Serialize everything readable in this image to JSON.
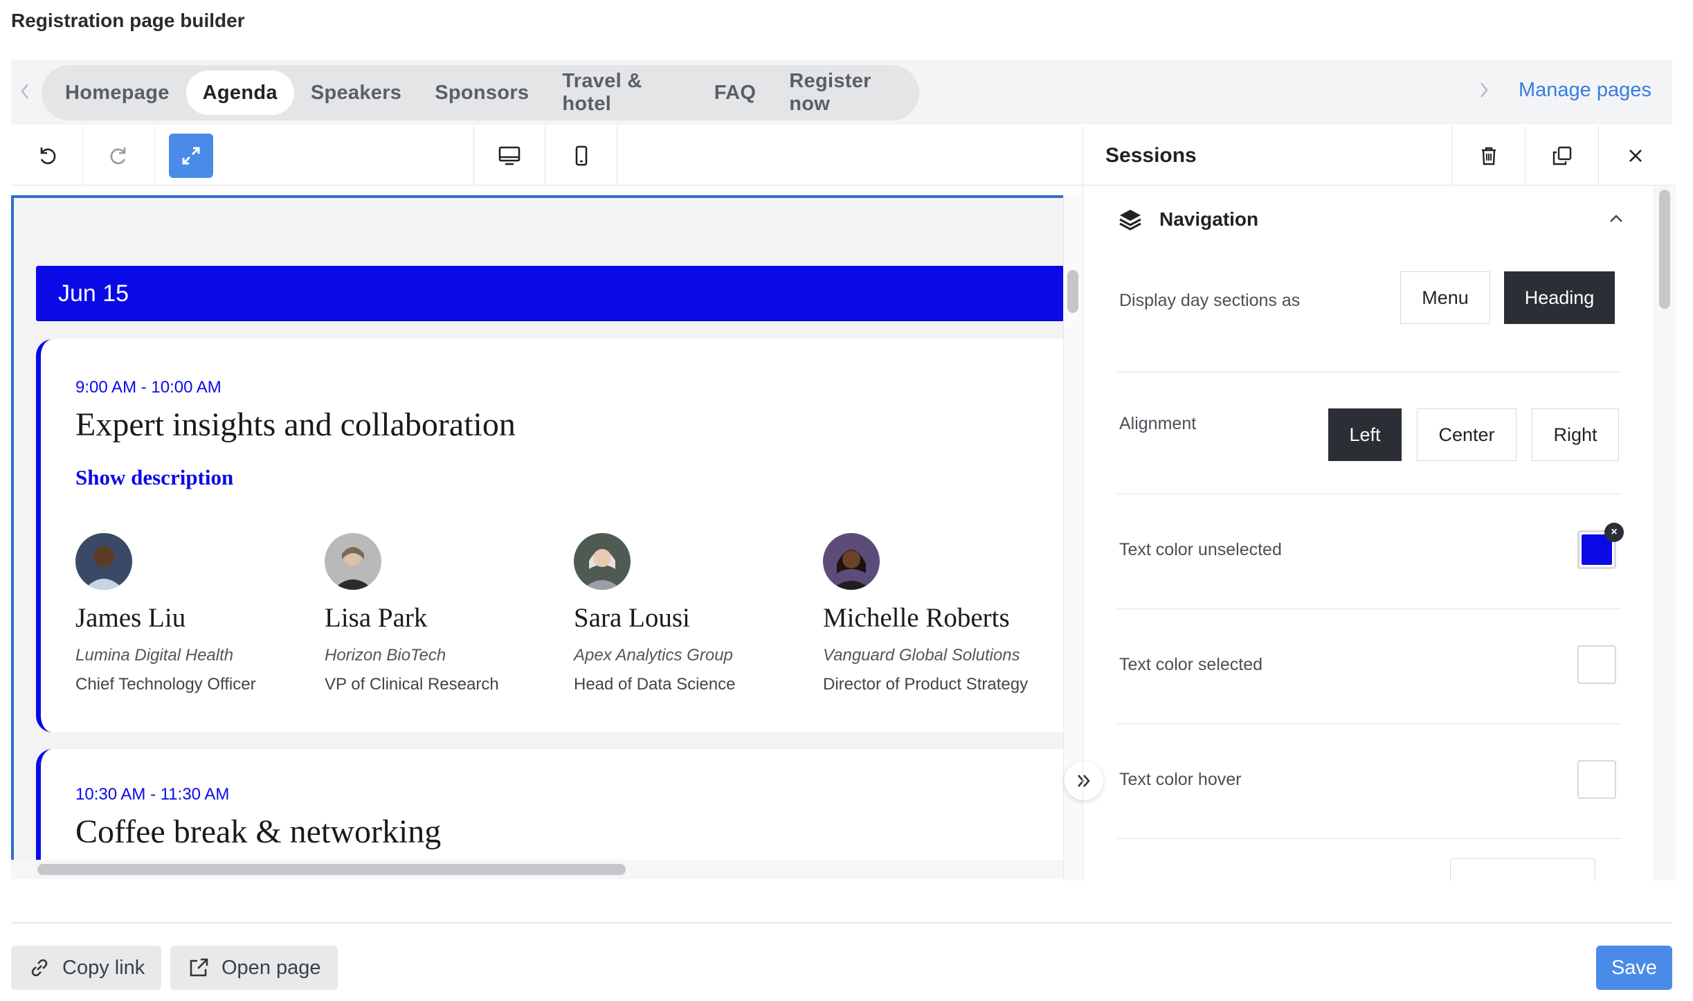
{
  "app": {
    "title": "Registration page builder"
  },
  "tabs": {
    "items": [
      {
        "label": "Homepage"
      },
      {
        "label": "Agenda"
      },
      {
        "label": "Speakers"
      },
      {
        "label": "Sponsors"
      },
      {
        "label": "Travel & hotel"
      },
      {
        "label": "FAQ"
      },
      {
        "label": "Register now"
      }
    ],
    "active": "Agenda",
    "manage_label": "Manage pages"
  },
  "canvas": {
    "day_label": "Jun 15",
    "sessions": [
      {
        "time": "9:00 AM - 10:00 AM",
        "title": "Expert insights and collaboration",
        "show_description": "Show description",
        "speakers": [
          {
            "name": "James Liu",
            "company": "Lumina Digital Health",
            "role": "Chief Technology Officer"
          },
          {
            "name": "Lisa Park",
            "company": "Horizon BioTech",
            "role": "VP of Clinical Research"
          },
          {
            "name": "Sara Lousi",
            "company": "Apex Analytics Group",
            "role": "Head of Data Science"
          },
          {
            "name": "Michelle Roberts",
            "company": "Vanguard Global Solutions",
            "role": "Director of Product Strategy"
          }
        ]
      },
      {
        "time": "10:30 AM - 11:30 AM",
        "title": "Coffee break & networking"
      }
    ]
  },
  "panel": {
    "title": "Sessions",
    "section_title": "Navigation",
    "display_label": "Display day sections as",
    "display_options": [
      "Menu",
      "Heading"
    ],
    "display_selected": "Heading",
    "alignment_label": "Alignment",
    "alignment_options": [
      "Left",
      "Center",
      "Right"
    ],
    "alignment_selected": "Left",
    "text_color_unselected_label": "Text color unselected",
    "text_color_unselected_value": "#0a0ae6",
    "text_color_selected_label": "Text color selected",
    "text_color_hover_label": "Text color hover"
  },
  "footer": {
    "copy_link": "Copy link",
    "open_page": "Open page",
    "save": "Save"
  },
  "colors": {
    "accent_blue": "#0a0ae6",
    "button_blue": "#4a8be8",
    "link_blue": "#3b7be0",
    "dark_selected": "#2b2f35"
  }
}
